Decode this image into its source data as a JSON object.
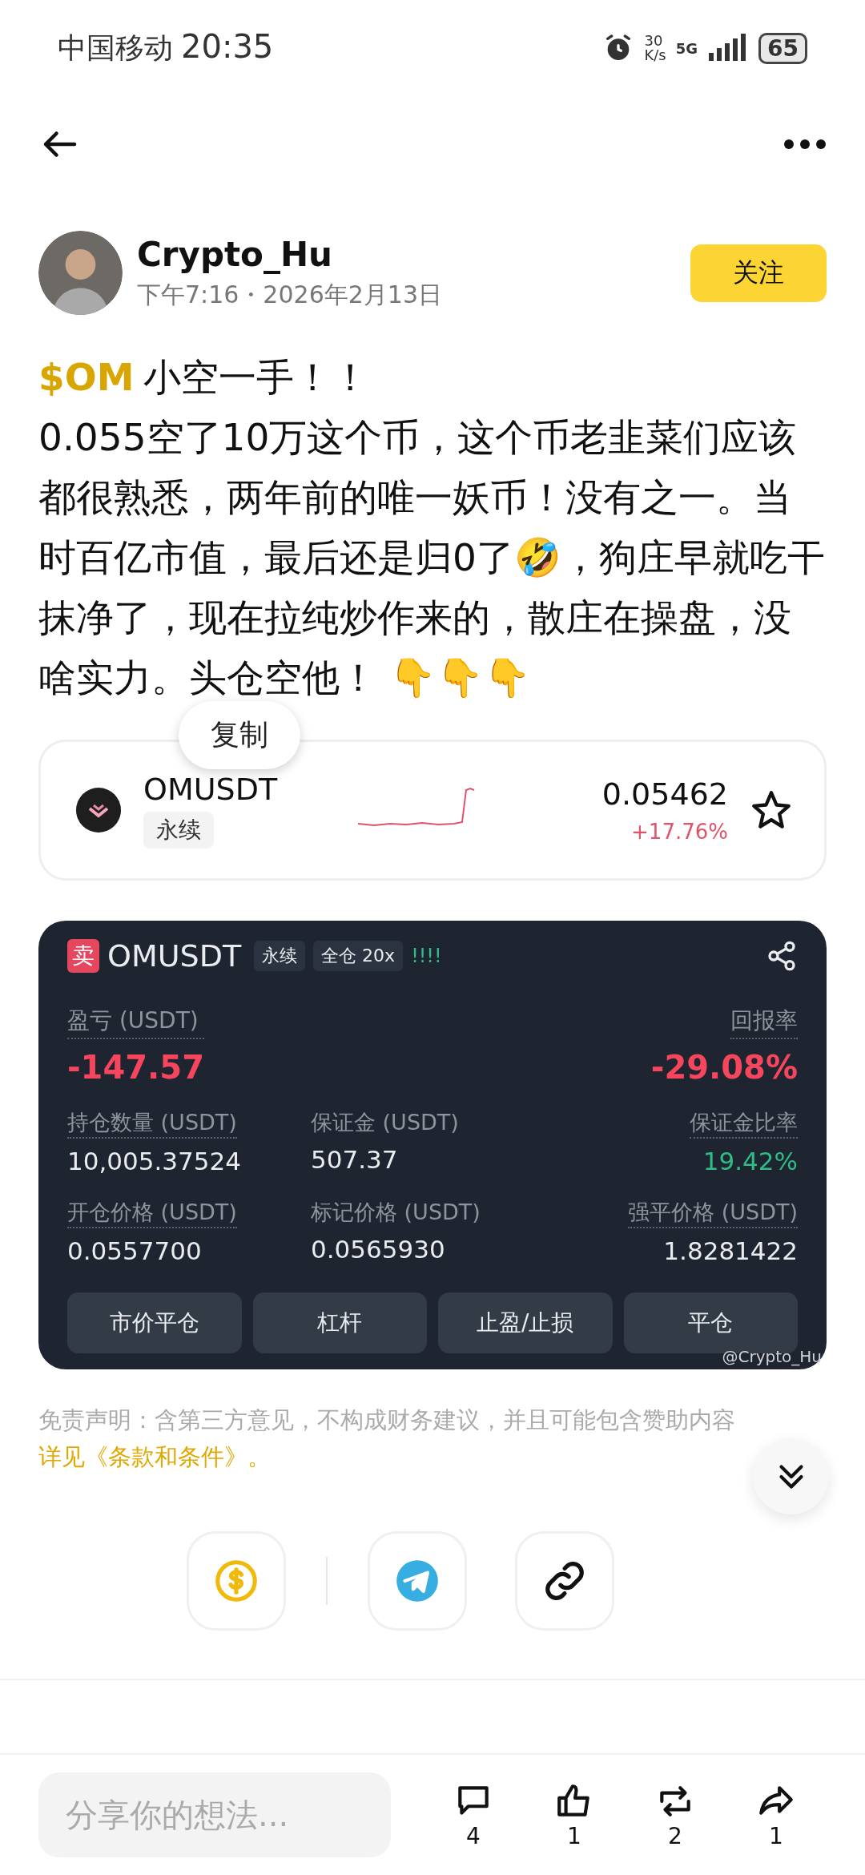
{
  "status_bar": {
    "carrier": "中国移动",
    "time": "20:35",
    "speed_value": "30",
    "speed_unit": "K/s",
    "network": "5G",
    "battery": "65"
  },
  "author": {
    "name": "Crypto_Hu",
    "meta": "下午7:16・2026年2月13日",
    "follow_label": "关注"
  },
  "post": {
    "ticker": "$OM",
    "lines": [
      "小空一手！！",
      "0.055空了10万这个币，这个币老韭菜们应该都很熟悉，两年前的唯一妖币！没有之一。当时百亿市值，最后还是归0了🤣，狗庄早就吃干抹净了，现在拉纯炒作来的，散庄在操盘，没啥实力。头仓空他！ 👇👇👇"
    ]
  },
  "copy_popup": {
    "label": "复制"
  },
  "market_card": {
    "symbol": "OMUSDT",
    "tag": "永续",
    "price": "0.05462",
    "change": "+17.76%",
    "favorited": false
  },
  "position_card": {
    "side": "卖",
    "symbol": "OMUSDT",
    "tags": [
      "永续",
      "全仓 20x"
    ],
    "leverage_marks": "!!!!",
    "pnl_label": "盈亏 (USDT)",
    "pnl": "-147.57",
    "roe_label": "回报率",
    "roe": "-29.08%",
    "stats": [
      {
        "label": "持仓数量 (USDT)",
        "value": "10,005.37524",
        "kind": "plain"
      },
      {
        "label": "保证金 (USDT)",
        "value": "507.37",
        "kind": "plain"
      },
      {
        "label": "保证金比率",
        "value": "19.42%",
        "kind": "positive"
      },
      {
        "label": "开仓价格 (USDT)",
        "value": "0.0557700",
        "kind": "plain"
      },
      {
        "label": "标记价格 (USDT)",
        "value": "0.0565930",
        "kind": "plain"
      },
      {
        "label": "强平价格 (USDT)",
        "value": "1.8281422",
        "kind": "plain"
      }
    ],
    "actions": [
      "市价平仓",
      "杠杆",
      "止盈/止损",
      "平仓"
    ],
    "credit": "@Crypto_Hu"
  },
  "disclaimer": {
    "text": "免责声明：含第三方意见，不构成财务建议，并且可能包含赞助内容",
    "link": "详见《条款和条件》。"
  },
  "share_buttons": [
    {
      "kind": "tip"
    },
    {
      "kind": "telegram"
    },
    {
      "kind": "link"
    }
  ],
  "composer": {
    "placeholder": "分享你的想法..."
  },
  "reactions": [
    {
      "kind": "comment",
      "count": "4"
    },
    {
      "kind": "like",
      "count": "1"
    },
    {
      "kind": "repost",
      "count": "2"
    },
    {
      "kind": "share",
      "count": "1"
    }
  ]
}
